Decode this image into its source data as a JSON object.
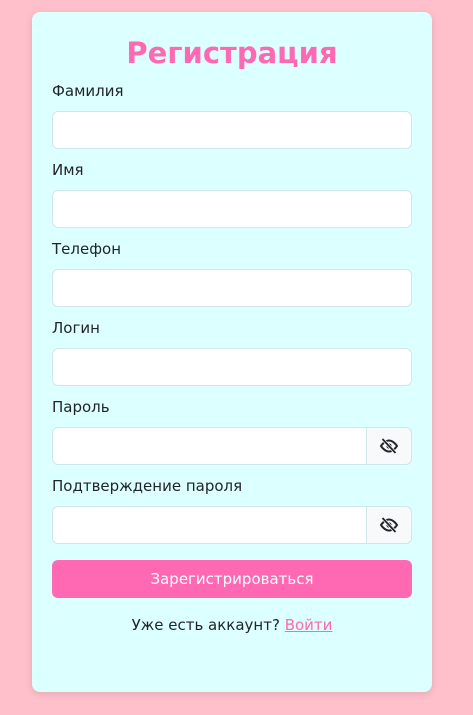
{
  "form": {
    "title": "Регистрация",
    "fields": {
      "last_name": {
        "label": "Фамилия",
        "value": ""
      },
      "first_name": {
        "label": "Имя",
        "value": ""
      },
      "phone": {
        "label": "Телефон",
        "value": ""
      },
      "login": {
        "label": "Логин",
        "value": ""
      },
      "password": {
        "label": "Пароль",
        "value": ""
      },
      "password_confirm": {
        "label": "Подтверждение пароля",
        "value": ""
      }
    },
    "submit_label": "Зарегистрироваться",
    "footer_text": "Уже есть аккаунт?",
    "login_link": "Войти"
  },
  "icons": {
    "password_toggle": "eye-slash-icon",
    "password_confirm_toggle": "eye-slash-icon"
  },
  "colors": {
    "background": "#ffc0cb",
    "card": "#dcffff",
    "accent": "#ff69b4"
  }
}
